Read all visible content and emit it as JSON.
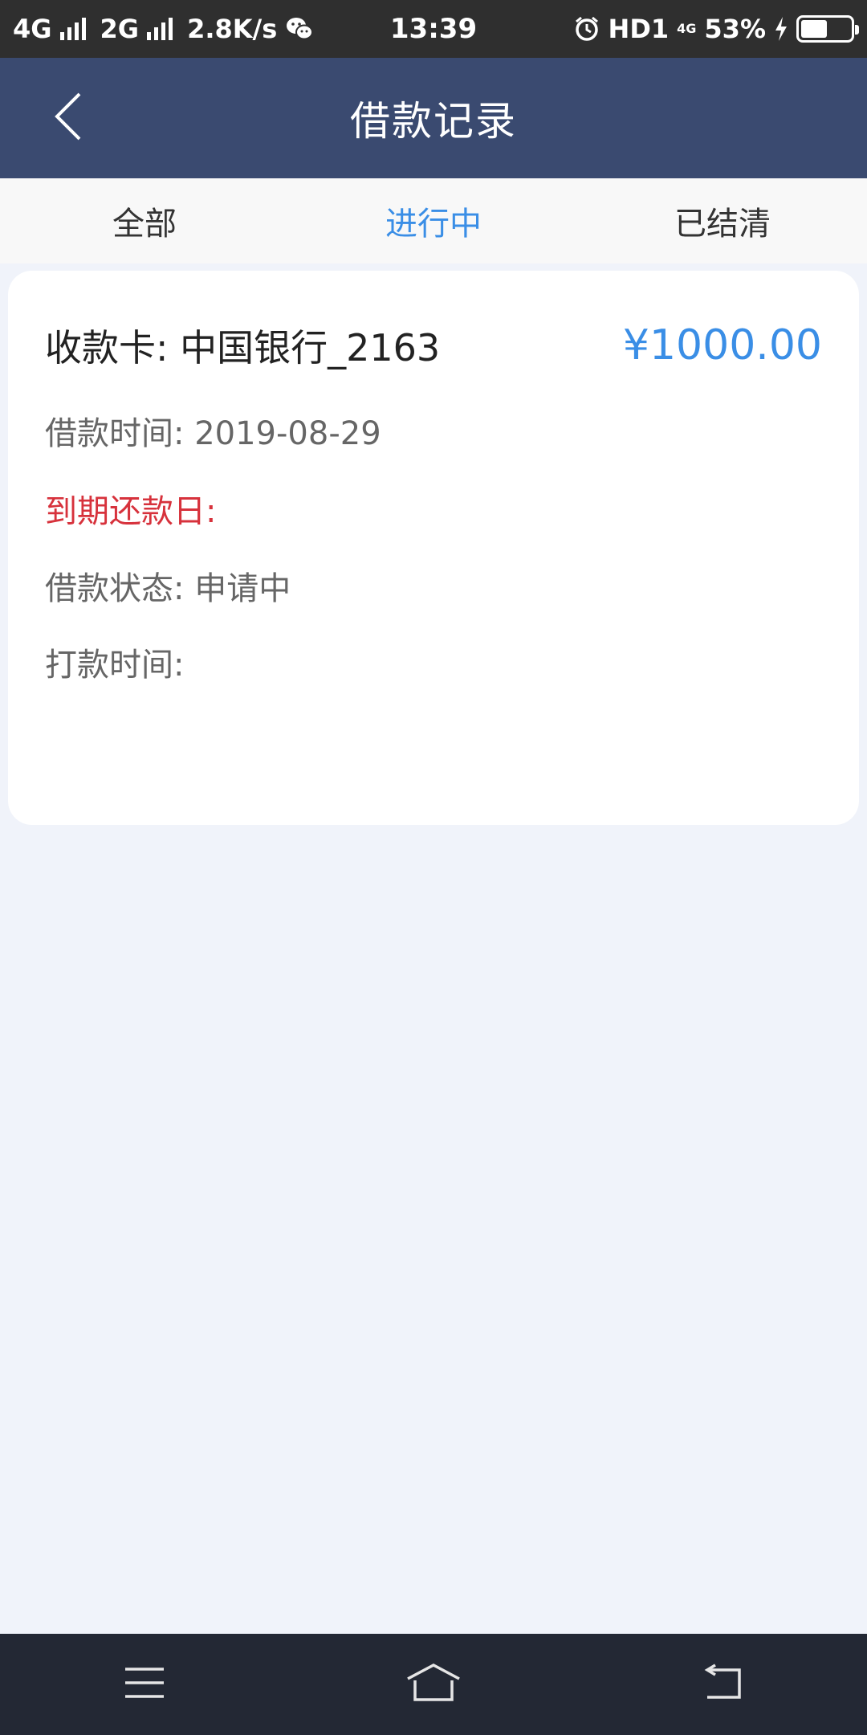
{
  "status_bar": {
    "net1": "4G",
    "net2": "2G",
    "speed": "2.8K/s",
    "time": "13:39",
    "hd": "HD1",
    "net_mini": "4G",
    "battery": "53%",
    "battery_level": 0.53,
    "icons": [
      "signal-icon",
      "wechat-icon",
      "alarm-icon",
      "charging-icon",
      "battery-icon"
    ]
  },
  "header": {
    "title": "借款记录",
    "back_icon": "chevron-left-icon"
  },
  "tabs": [
    {
      "label": "全部",
      "active": false
    },
    {
      "label": "进行中",
      "active": true
    },
    {
      "label": "已结清",
      "active": false
    }
  ],
  "record": {
    "title": "收款卡: 中国银行_2163",
    "amount": "¥1000.00",
    "loan_time": "借款时间: 2019-08-29",
    "due_date": "到期还款日:",
    "status": "借款状态: 申请中",
    "payment_time": "打款时间:"
  },
  "nav": {
    "icons": [
      "menu-icon",
      "home-icon",
      "back-icon"
    ]
  },
  "colors": {
    "header_bg": "#3a4a70",
    "accent": "#3a8ee6",
    "warning": "#d7323c",
    "page_bg": "#f0f3fa",
    "status_bar_bg": "#2f2f2f",
    "nav_bg": "#232834"
  }
}
